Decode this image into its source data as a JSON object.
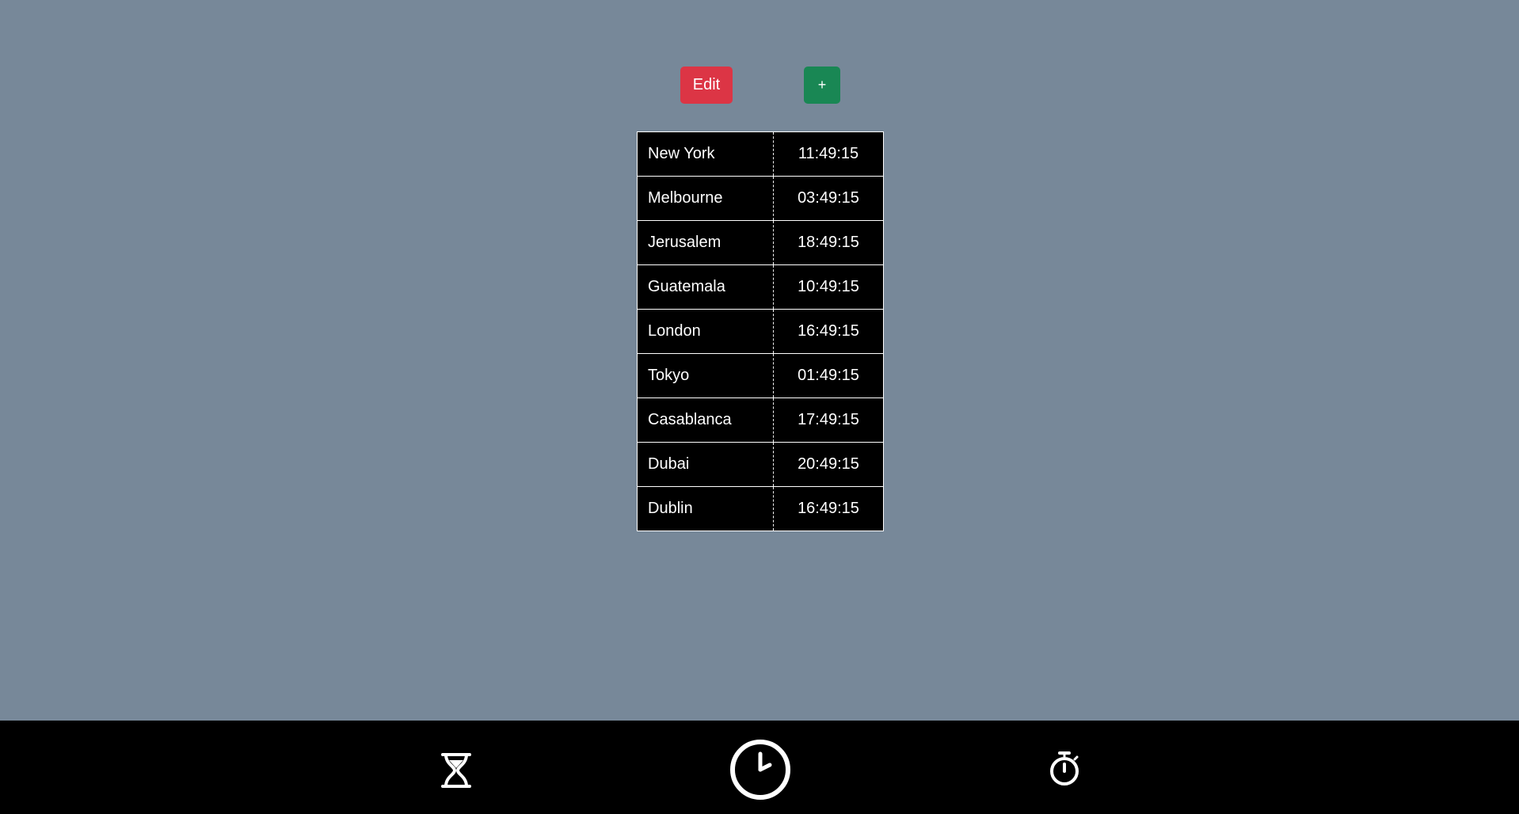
{
  "toolbar": {
    "edit_label": "Edit",
    "add_label": "+"
  },
  "clocks": [
    {
      "city": "New York",
      "time": "11:49:15"
    },
    {
      "city": "Melbourne",
      "time": "03:49:15"
    },
    {
      "city": "Jerusalem",
      "time": "18:49:15"
    },
    {
      "city": "Guatemala",
      "time": "10:49:15"
    },
    {
      "city": "London",
      "time": "16:49:15"
    },
    {
      "city": "Tokyo",
      "time": "01:49:15"
    },
    {
      "city": "Casablanca",
      "time": "17:49:15"
    },
    {
      "city": "Dubai",
      "time": "20:49:15"
    },
    {
      "city": "Dublin",
      "time": "16:49:15"
    }
  ],
  "footer_nav": {
    "items": [
      {
        "icon": "hourglass-icon",
        "target": "timer"
      },
      {
        "icon": "clock-icon",
        "target": "world-clock"
      },
      {
        "icon": "stopwatch-icon",
        "target": "stopwatch"
      }
    ]
  },
  "colors": {
    "background": "#778899",
    "edit_button": "#dc3545",
    "add_button": "#198754",
    "table_bg": "#000000",
    "footer_bg": "#000000",
    "text": "#ffffff"
  }
}
